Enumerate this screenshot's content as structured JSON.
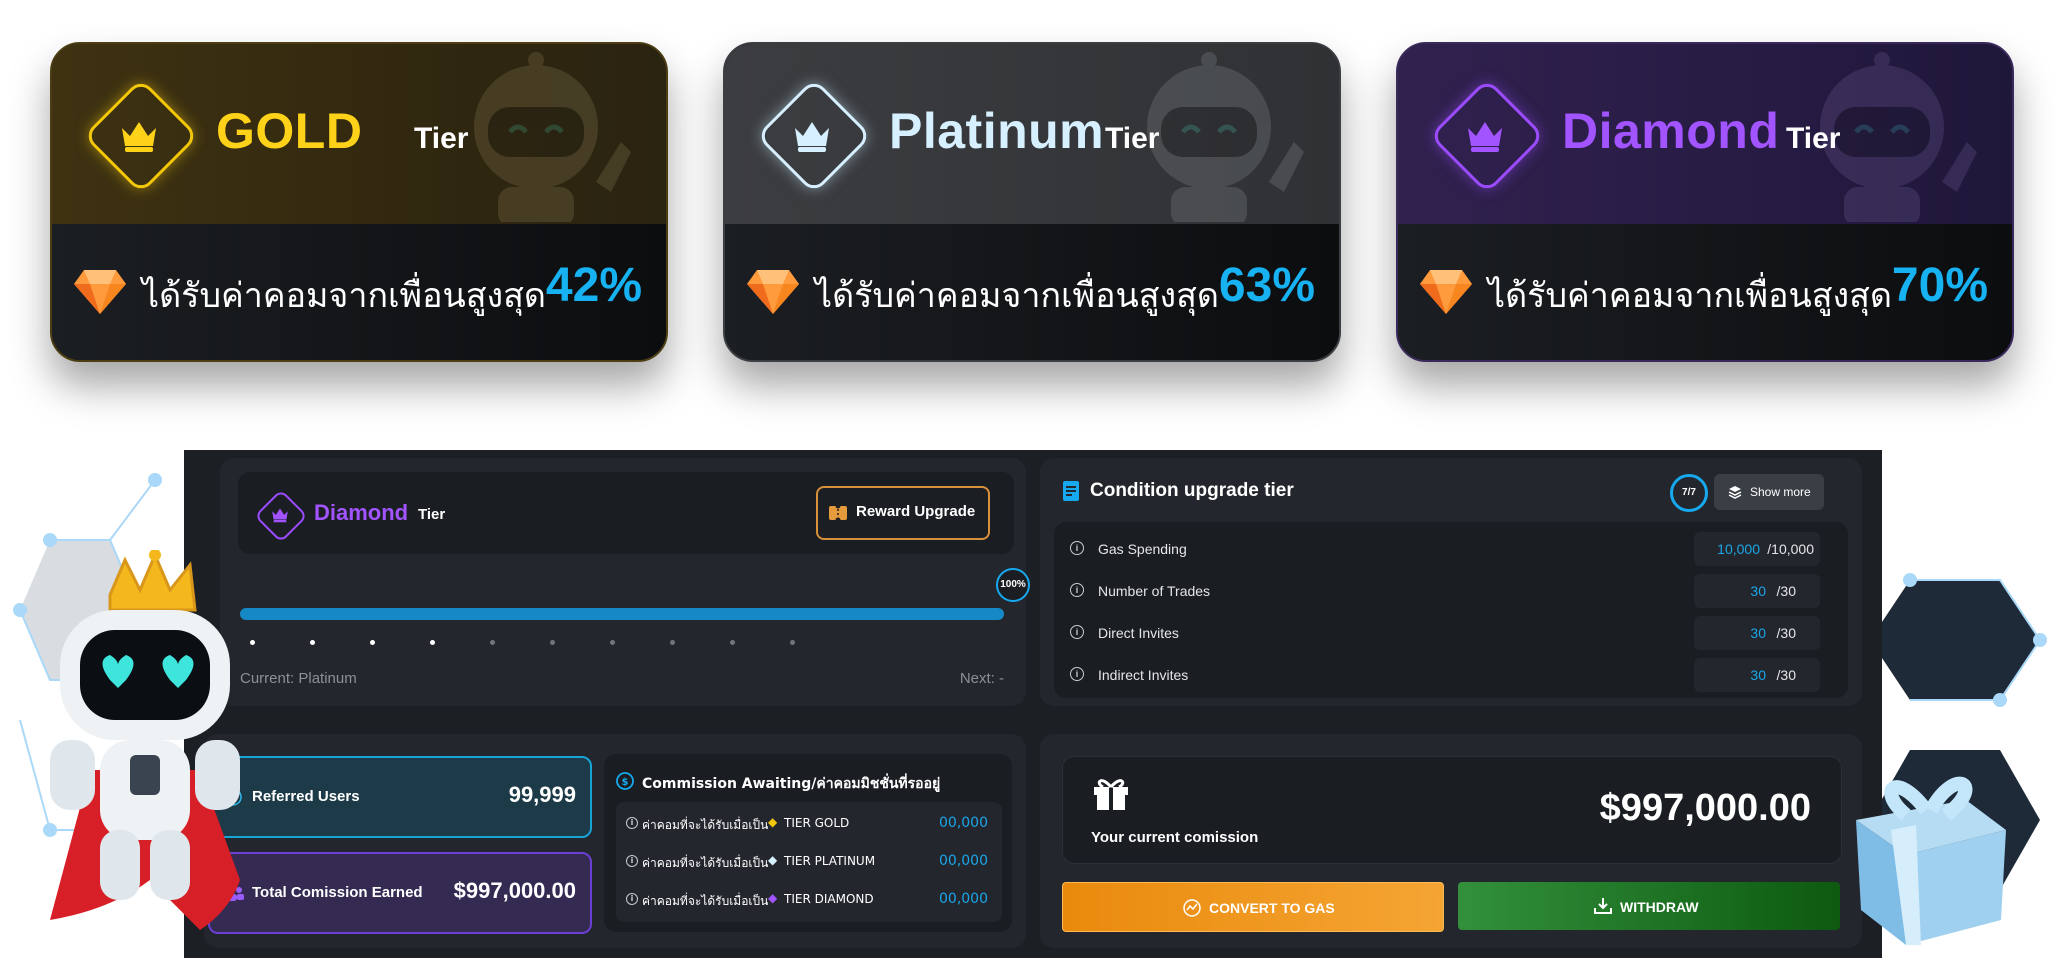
{
  "tiers": [
    {
      "name": "GOLD",
      "suffix": "Tier",
      "commission_text": "ได้รับค่าคอมจากเพื่อนสูงสุด",
      "percent": "42%"
    },
    {
      "name": "Platinum",
      "suffix": "Tier",
      "commission_text": "ได้รับค่าคอมจากเพื่อนสูงสุด",
      "percent": "63%"
    },
    {
      "name": "Diamond",
      "suffix": "Tier",
      "commission_text": "ได้รับค่าคอมจากเพื่อนสูงสุด",
      "percent": "70%"
    }
  ],
  "current_tier": {
    "name": "Diamond",
    "suffix": "Tier",
    "reward_button": "Reward Upgrade",
    "progress_label": "100%",
    "progress_fraction": 1.0,
    "current_label": "Current: Platinum",
    "next_label": "Next: -"
  },
  "condition": {
    "title": "Condition upgrade tier",
    "ring_label": "7/7",
    "show_more": "Show more",
    "rows": [
      {
        "label": "Gas Spending",
        "value": "10,000",
        "total": "/10,000"
      },
      {
        "label": "Number of Trades",
        "value": "30",
        "total": "/30"
      },
      {
        "label": "Direct Invites",
        "value": "30",
        "total": "/30"
      },
      {
        "label": "Indirect Invites",
        "value": "30",
        "total": "/30"
      }
    ]
  },
  "stats": {
    "referred_label": "Referred Users",
    "referred_value": "99,999",
    "earned_label": "Total Comission Earned",
    "earned_value": "$997,000.00"
  },
  "awaiting": {
    "title": "Commission Awaiting/ค่าคอมมิชชั่นที่รออยู่",
    "rows": [
      {
        "prefix": "ค่าคอมที่จะได้รับเมื่อเป็น",
        "tier": "TIER GOLD",
        "value": "00,000"
      },
      {
        "prefix": "ค่าคอมที่จะได้รับเมื่อเป็น",
        "tier": "TIER PLATINUM",
        "value": "00,000"
      },
      {
        "prefix": "ค่าคอมที่จะได้รับเมื่อเป็น",
        "tier": "TIER DIAMOND",
        "value": "00,000"
      }
    ]
  },
  "current_commission": {
    "label": "Your current comission",
    "value": "$997,000.00",
    "convert_button": "CONVERT TO GAS",
    "withdraw_button": "WITHDRAW"
  },
  "colors": {
    "gold": "#ffd21a",
    "platinum": "#d6f0ff",
    "diamond": "#a154ff",
    "accent_blue": "#17b2f2",
    "convert_orange": "#f5a534",
    "withdraw_green": "#2e8a37"
  },
  "icons": [
    "crown-icon",
    "gem-icon",
    "receipt-icon",
    "layers-icon",
    "info-icon",
    "chart-icon",
    "users-icon",
    "gift-icon",
    "download-icon",
    "ticket-icon"
  ]
}
